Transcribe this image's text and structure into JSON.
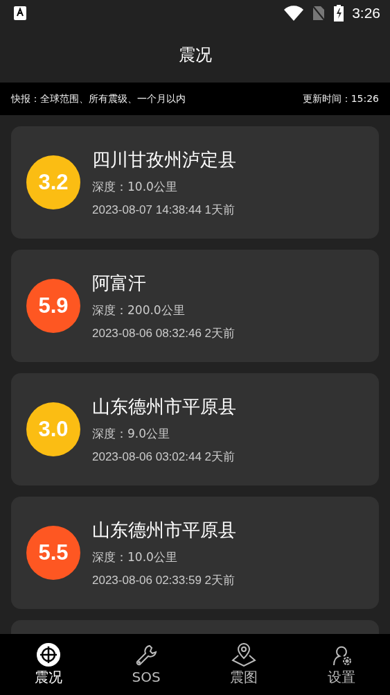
{
  "status_bar": {
    "time": "3:26"
  },
  "header": {
    "title": "震况"
  },
  "ticker": {
    "summary": "快报：全球范围、所有震级、一个月以内",
    "updated": "更新时间：15:26"
  },
  "quakes": [
    {
      "magnitude": "3.2",
      "color": "#fbbd13",
      "place": "四川甘孜州泸定县",
      "depth": "深度：10.0公里",
      "time": "2023-08-07 14:38:44 1天前"
    },
    {
      "magnitude": "5.9",
      "color": "#fe5722",
      "place": "阿富汗",
      "depth": "深度：200.0公里",
      "time": "2023-08-06 08:32:46 2天前"
    },
    {
      "magnitude": "3.0",
      "color": "#fbbd13",
      "place": "山东德州市平原县",
      "depth": "深度：9.0公里",
      "time": "2023-08-06 03:02:44 2天前"
    },
    {
      "magnitude": "5.5",
      "color": "#fe5722",
      "place": "山东德州市平原县",
      "depth": "深度：10.0公里",
      "time": "2023-08-06 02:33:59 2天前"
    }
  ],
  "nav": [
    {
      "kind": "quake",
      "label": "震况",
      "selected": true
    },
    {
      "kind": "sos",
      "label": "SOS",
      "selected": false
    },
    {
      "kind": "map",
      "label": "震图",
      "selected": false
    },
    {
      "kind": "settings",
      "label": "设置",
      "selected": false
    }
  ]
}
